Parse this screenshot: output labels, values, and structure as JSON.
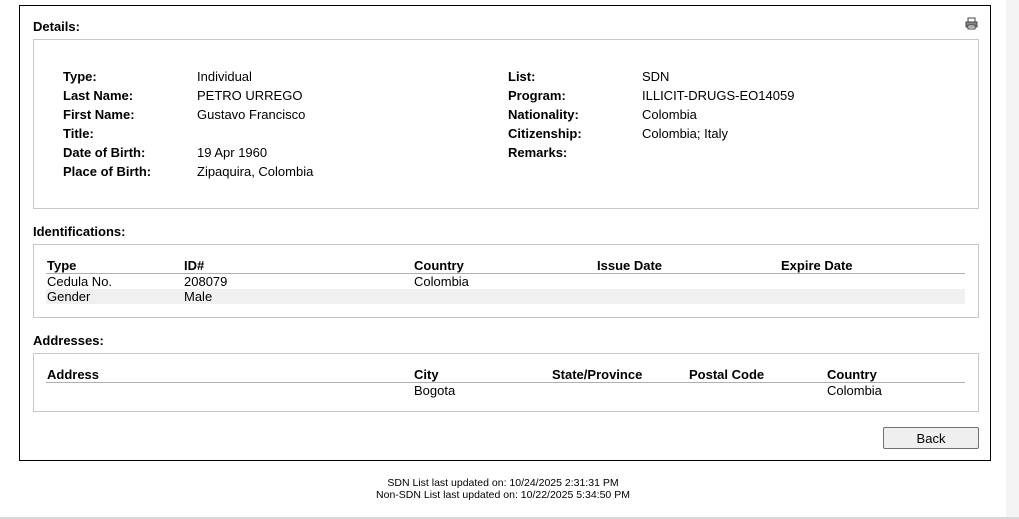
{
  "details": {
    "title": "Details:",
    "left": [
      {
        "label": "Type:",
        "value": "Individual"
      },
      {
        "label": "Last Name:",
        "value": "PETRO URREGO"
      },
      {
        "label": "First Name:",
        "value": "Gustavo Francisco"
      },
      {
        "label": "Title:",
        "value": ""
      },
      {
        "label": "Date of Birth:",
        "value": "19 Apr 1960"
      },
      {
        "label": "Place of Birth:",
        "value": "Zipaquira, Colombia"
      }
    ],
    "right": [
      {
        "label": "List:",
        "value": "SDN"
      },
      {
        "label": "Program:",
        "value": "ILLICIT-DRUGS-EO14059"
      },
      {
        "label": "Nationality:",
        "value": "Colombia"
      },
      {
        "label": "Citizenship:",
        "value": "Colombia; Italy"
      },
      {
        "label": "Remarks:",
        "value": ""
      }
    ]
  },
  "identifications": {
    "title": "Identifications:",
    "columns": [
      "Type",
      "ID#",
      "Country",
      "Issue Date",
      "Expire Date"
    ],
    "rows": [
      [
        "Cedula No.",
        "208079",
        "Colombia",
        "",
        ""
      ],
      [
        "Gender",
        "Male",
        "",
        "",
        ""
      ]
    ]
  },
  "addresses": {
    "title": "Addresses:",
    "columns": [
      "Address",
      "City",
      "State/Province",
      "Postal Code",
      "Country"
    ],
    "rows": [
      [
        "",
        "Bogota",
        "",
        "",
        "Colombia"
      ]
    ]
  },
  "back_label": "Back",
  "footer": {
    "sdn": "SDN List last updated on: 10/24/2025 2:31:31 PM",
    "non_sdn": "Non-SDN List last updated on: 10/22/2025 5:34:50 PM"
  },
  "icons": {
    "print": "print-icon"
  }
}
